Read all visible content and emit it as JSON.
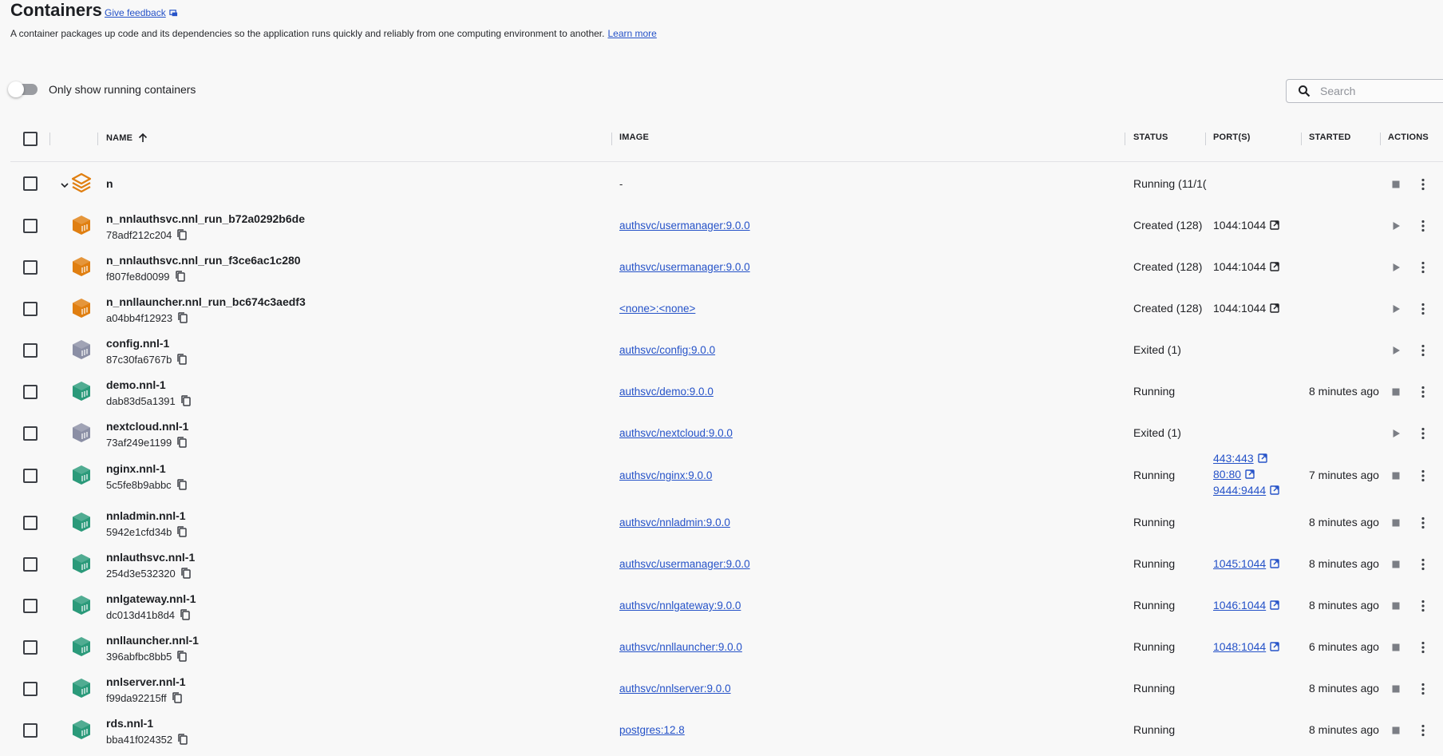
{
  "page": {
    "title": "Containers",
    "feedback": "Give feedback",
    "description": "A container packages up code and its dependencies so the application runs quickly and reliably from one computing environment to another.",
    "learn_more": "Learn more",
    "toggle_label": "Only show running containers",
    "search_placeholder": "Search"
  },
  "colors": {
    "link": "#2552c8",
    "running_container": "#2b9a7a",
    "created_container": "#e07f11",
    "exited_container": "#8b8fa5",
    "group_icon": "#e07f11"
  },
  "columns": {
    "name": "NAME",
    "image": "IMAGE",
    "status": "STATUS",
    "ports": "PORT(S)",
    "started": "STARTED",
    "actions": "ACTIONS"
  },
  "group": {
    "name": "n",
    "image": "-",
    "status": "Running (11/1("
  },
  "containers": [
    {
      "name": "n_nnlauthsvc.nnl_run_b72a0292b6de",
      "id": "78adf212c204",
      "image": "authsvc/usermanager:9.0.0",
      "status": "Created (128)",
      "ports": [
        "1044:1044"
      ],
      "ports_link": false,
      "started": "",
      "state": "created"
    },
    {
      "name": "n_nnlauthsvc.nnl_run_f3ce6ac1c280",
      "id": "f807fe8d0099",
      "image": "authsvc/usermanager:9.0.0",
      "status": "Created (128)",
      "ports": [
        "1044:1044"
      ],
      "ports_link": false,
      "started": "",
      "state": "created"
    },
    {
      "name": "n_nnllauncher.nnl_run_bc674c3aedf3",
      "id": "a04bb4f12923",
      "image": "<none>:<none>",
      "status": "Created (128)",
      "ports": [
        "1044:1044"
      ],
      "ports_link": false,
      "started": "",
      "state": "created"
    },
    {
      "name": "config.nnl-1",
      "id": "87c30fa6767b",
      "image": "authsvc/config:9.0.0",
      "status": "Exited (1)",
      "ports": [],
      "ports_link": false,
      "started": "",
      "state": "exited"
    },
    {
      "name": "demo.nnl-1",
      "id": "dab83d5a1391",
      "image": "authsvc/demo:9.0.0",
      "status": "Running",
      "ports": [],
      "ports_link": false,
      "started": "8 minutes ago",
      "state": "running"
    },
    {
      "name": "nextcloud.nnl-1",
      "id": "73af249e1199",
      "image": "authsvc/nextcloud:9.0.0",
      "status": "Exited (1)",
      "ports": [],
      "ports_link": false,
      "started": "",
      "state": "exited"
    },
    {
      "name": "nginx.nnl-1",
      "id": "5c5fe8b9abbc",
      "image": "authsvc/nginx:9.0.0",
      "status": "Running",
      "ports": [
        "443:443",
        "80:80",
        "9444:9444"
      ],
      "ports_link": true,
      "started": "7 minutes ago",
      "state": "running"
    },
    {
      "name": "nnladmin.nnl-1",
      "id": "5942e1cfd34b",
      "image": "authsvc/nnladmin:9.0.0",
      "status": "Running",
      "ports": [],
      "ports_link": false,
      "started": "8 minutes ago",
      "state": "running"
    },
    {
      "name": "nnlauthsvc.nnl-1",
      "id": "254d3e532320",
      "image": "authsvc/usermanager:9.0.0",
      "status": "Running",
      "ports": [
        "1045:1044"
      ],
      "ports_link": true,
      "started": "8 minutes ago",
      "state": "running"
    },
    {
      "name": "nnlgateway.nnl-1",
      "id": "dc013d41b8d4",
      "image": "authsvc/nnlgateway:9.0.0",
      "status": "Running",
      "ports": [
        "1046:1044"
      ],
      "ports_link": true,
      "started": "8 minutes ago",
      "state": "running"
    },
    {
      "name": "nnllauncher.nnl-1",
      "id": "396abfbc8bb5",
      "image": "authsvc/nnllauncher:9.0.0",
      "status": "Running",
      "ports": [
        "1048:1044"
      ],
      "ports_link": true,
      "started": "6 minutes ago",
      "state": "running"
    },
    {
      "name": "nnlserver.nnl-1",
      "id": "f99da92215ff",
      "image": "authsvc/nnlserver:9.0.0",
      "status": "Running",
      "ports": [],
      "ports_link": false,
      "started": "8 minutes ago",
      "state": "running"
    },
    {
      "name": "rds.nnl-1",
      "id": "bba41f024352",
      "image": "postgres:12.8",
      "status": "Running",
      "ports": [],
      "ports_link": false,
      "started": "8 minutes ago",
      "state": "running"
    }
  ]
}
